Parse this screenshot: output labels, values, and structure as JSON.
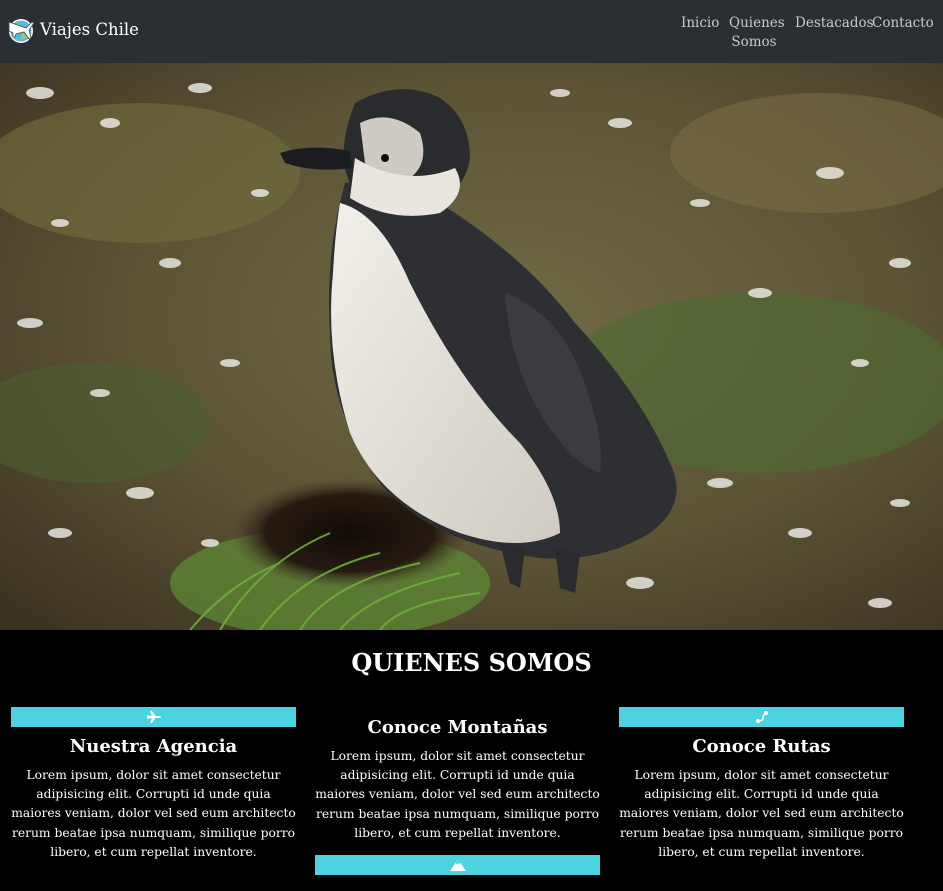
{
  "brand": {
    "name": "Viajes Chile",
    "logo_icon": "globe-plane-icon"
  },
  "nav": {
    "items": [
      {
        "label": "Inicio"
      },
      {
        "label": "Quienes"
      },
      {
        "label": "Somos"
      },
      {
        "label": "Destacados"
      },
      {
        "label": "Contacto"
      }
    ]
  },
  "hero": {
    "subject_icon": "penguin-photo"
  },
  "about": {
    "title": "QUIENES SOMOS",
    "cards": [
      {
        "icon": "plane-icon",
        "title": "Nuestra Agencia",
        "text": "Lorem ipsum, dolor sit amet consectetur adipisicing elit. Corrupti id unde quia maiores veniam, dolor vel sed eum architecto rerum beatae ipsa numquam, similique porro libero, et cum repellat inventore."
      },
      {
        "icon": "mountain-icon",
        "title": "Conoce Montañas",
        "text": "Lorem ipsum, dolor sit amet consectetur adipisicing elit. Corrupti id unde quia maiores veniam, dolor vel sed eum architecto rerum beatae ipsa numquam, similique porro libero, et cum repellat inventore."
      },
      {
        "icon": "route-icon",
        "title": "Conoce Rutas",
        "text": "Lorem ipsum, dolor sit amet consectetur adipisicing elit. Corrupti id unde quia maiores veniam, dolor vel sed eum architecto rerum beatae ipsa numquam, similique porro libero, et cum repellat inventore."
      }
    ]
  },
  "colors": {
    "navbar": "#2b2f33",
    "accent": "#4bd3df",
    "background": "#000000",
    "text": "#ffffff"
  }
}
